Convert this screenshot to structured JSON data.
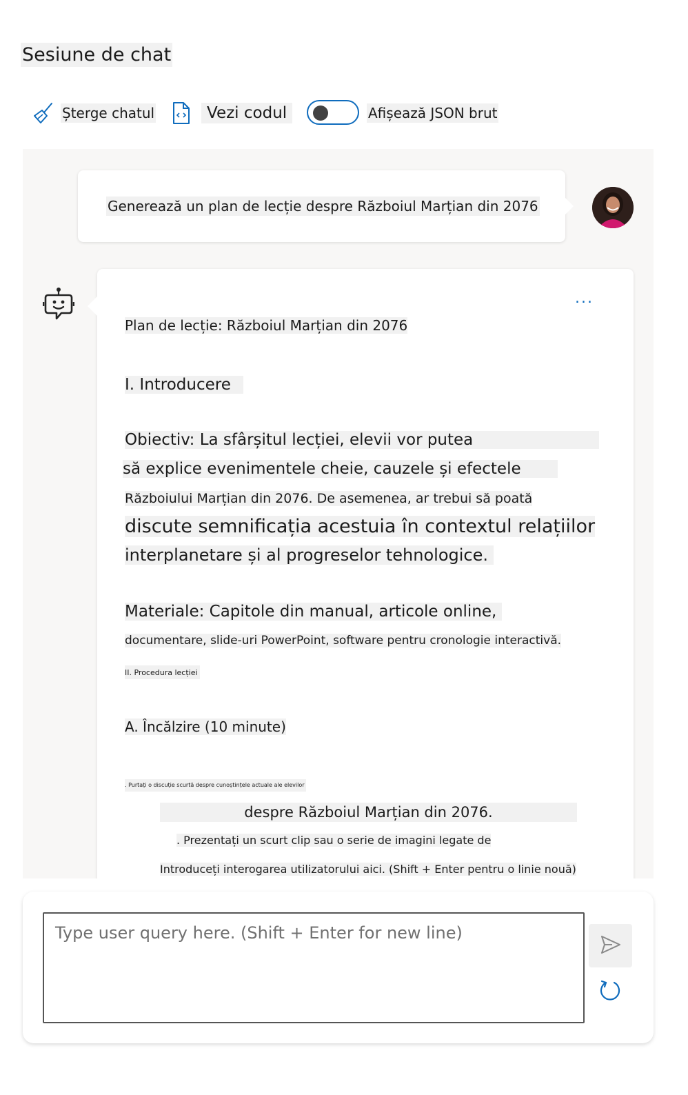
{
  "page": {
    "title": "Sesiune de chat"
  },
  "toolbar": {
    "clear_label": "Șterge chatul",
    "code_label": "Vezi codul",
    "json_label": "Afișează JSON brut",
    "json_toggle_on": false
  },
  "icons": {
    "clear": "broom-icon",
    "code": "code-file-icon",
    "bot": "bot-icon",
    "send": "send-icon",
    "refresh": "refresh-icon",
    "more": "more-options-icon"
  },
  "colors": {
    "accent": "#0f6cbd",
    "chat_bg": "#f8f7f6"
  },
  "chat": {
    "user_message": "Generează un plan de lecție despre Războiul Marțian din 2076",
    "more_label": "...",
    "assistant_lines": [
      "Plan de lecție: Războiul Marțian din 2076",
      "I. Introducere",
      "Obiectiv: La sfârșitul lecției, elevii vor putea",
      "să explice evenimentele cheie, cauzele și efectele",
      "Războiului Marțian din 2076. De asemenea, ar trebui să poată",
      "discute semnificația acestuia în contextul relațiilor",
      "interplanetare și al progreselor tehnologice.",
      "Materiale: Capitole din manual, articole online,",
      "documentare, slide-uri PowerPoint, software pentru cronologie interactivă.",
      "II. Procedura lecției",
      "A. Încălzire (10 minute)",
      ". Purtați o discuție scurtă despre cunoștințele actuale ale elevilor",
      "despre Războiul Marțian din 2076.",
      ". Prezentați un scurt clip sau o serie de imagini legate de",
      "Introduceți interogarea utilizatorului aici. (Shift + Enter pentru o linie nouă)"
    ]
  },
  "composer": {
    "placeholder": "Type user query here. (Shift + Enter for new line)",
    "value": ""
  }
}
